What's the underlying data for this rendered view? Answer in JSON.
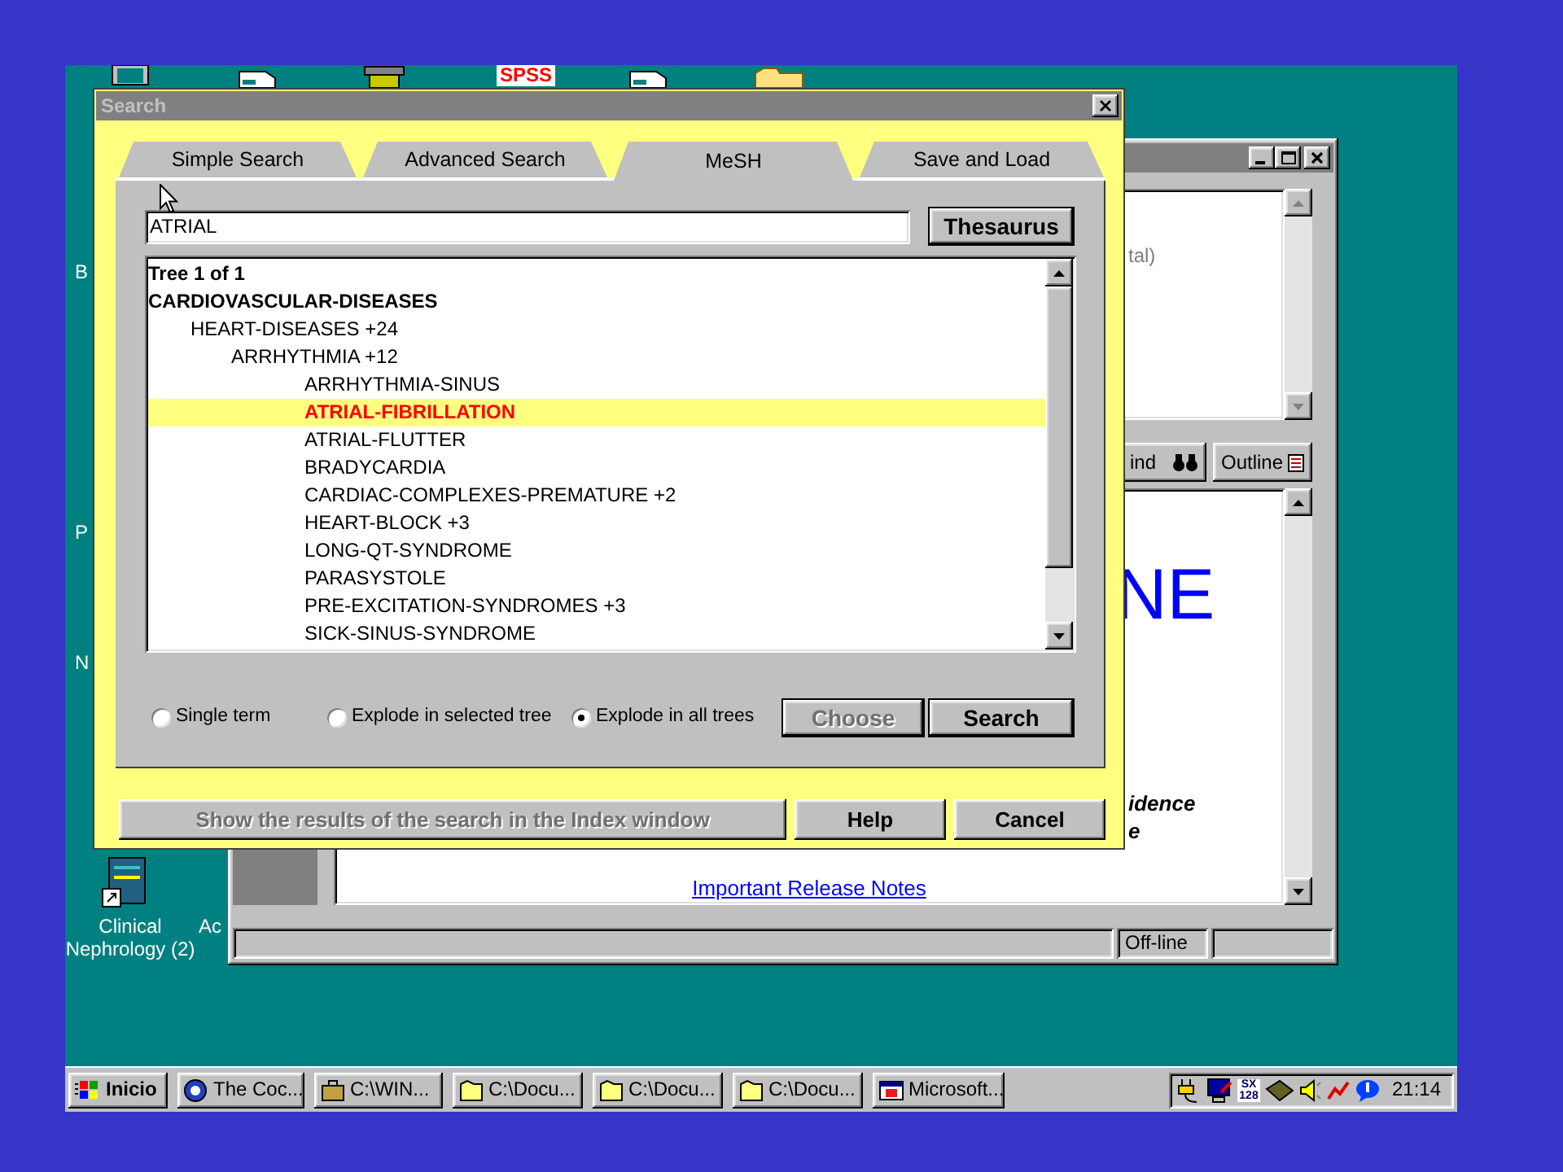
{
  "desktop": {
    "top_icons": [
      {
        "kind": "monitor"
      },
      {
        "kind": "document"
      },
      {
        "kind": "scanner"
      },
      {
        "kind": "text",
        "label": "SPSS"
      },
      {
        "kind": "document"
      },
      {
        "kind": "folder"
      }
    ],
    "cut_labels": [
      "B",
      "P",
      "N",
      "Ac"
    ],
    "icons": [
      {
        "label": "Clinical Nephrology (2)"
      }
    ]
  },
  "background_window": {
    "upper_text": "tal)",
    "toolbar": [
      {
        "label": "ind",
        "kind": "binoculars"
      },
      {
        "label": "Outline",
        "kind": "outline"
      }
    ],
    "heading_fragment": "NE",
    "bold_fragments": [
      "idence",
      "e"
    ],
    "link": "Important Release Notes",
    "status_fields": [
      "Off-line"
    ]
  },
  "dialog": {
    "title": "Search",
    "tabs": [
      {
        "label": "Simple Search",
        "selected": false
      },
      {
        "label": "Advanced Search",
        "selected": false
      },
      {
        "label": "MeSH",
        "selected": true
      },
      {
        "label": "Save and Load",
        "selected": false
      }
    ],
    "search_value": "ATRIAL",
    "thesaurus_button": "Thesaurus",
    "tree": {
      "header": "Tree 1 of 1",
      "nodes": [
        {
          "label": "CARDIOVASCULAR-DISEASES",
          "selected": false,
          "children": [
            {
              "label": "HEART-DISEASES +24",
              "selected": false,
              "children": [
                {
                  "label": "ARRHYTHMIA +12",
                  "selected": false,
                  "children": [
                    {
                      "label": "ARRHYTHMIA-SINUS",
                      "selected": false
                    },
                    {
                      "label": "ATRIAL-FIBRILLATION",
                      "selected": true
                    },
                    {
                      "label": "ATRIAL-FLUTTER",
                      "selected": false
                    },
                    {
                      "label": "BRADYCARDIA",
                      "selected": false
                    },
                    {
                      "label": "CARDIAC-COMPLEXES-PREMATURE +2",
                      "selected": false
                    },
                    {
                      "label": "HEART-BLOCK +3",
                      "selected": false
                    },
                    {
                      "label": "LONG-QT-SYNDROME",
                      "selected": false
                    },
                    {
                      "label": "PARASYSTOLE",
                      "selected": false
                    },
                    {
                      "label": "PRE-EXCITATION-SYNDROMES +3",
                      "selected": false
                    },
                    {
                      "label": "SICK-SINUS-SYNDROME",
                      "selected": false
                    }
                  ]
                }
              ]
            }
          ]
        }
      ]
    },
    "radios": [
      {
        "label": "Single term",
        "selected": false
      },
      {
        "label": "Explode in selected tree",
        "selected": false
      },
      {
        "label": "Explode in all trees",
        "selected": true
      }
    ],
    "buttons": [
      {
        "label": "Choose",
        "disabled": true
      },
      {
        "label": "Search",
        "disabled": false
      }
    ],
    "footer_buttons": [
      {
        "label": "Show the results of the search in the Index window",
        "disabled": true
      },
      {
        "label": "Help",
        "disabled": false
      },
      {
        "label": "Cancel",
        "disabled": false
      }
    ]
  },
  "taskbar": {
    "start": "Inicio",
    "tasks": [
      {
        "label": "The Coc...",
        "kind": "globe"
      },
      {
        "label": "C:\\WIN...",
        "kind": "briefcase"
      },
      {
        "label": "C:\\Docu...",
        "kind": "folder"
      },
      {
        "label": "C:\\Docu...",
        "kind": "folder"
      },
      {
        "label": "C:\\Docu...",
        "kind": "folder"
      },
      {
        "label": "Microsoft...",
        "kind": "window"
      }
    ],
    "memory_label": "SX 128",
    "clock": "21:14"
  }
}
